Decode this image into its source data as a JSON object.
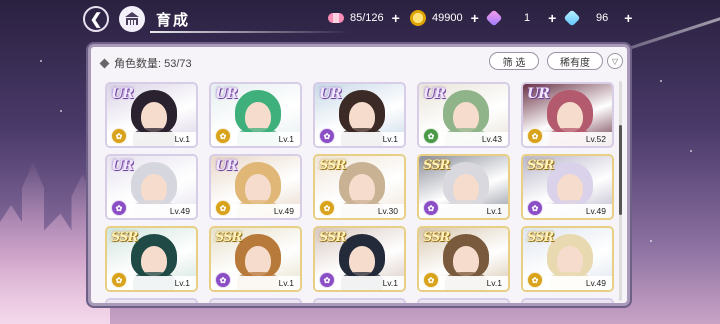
{
  "header": {
    "back_icon": "back-arrow-icon",
    "home_icon": "academy-icon",
    "title": "育成"
  },
  "resources": [
    {
      "icon": "candy-icon",
      "value": "85/126",
      "plus": "+"
    },
    {
      "icon": "coin-icon",
      "value": "49900",
      "plus": "+"
    },
    {
      "icon": "pink-gem-icon",
      "value": "1",
      "plus": "+"
    },
    {
      "icon": "blue-gem-icon",
      "value": "96",
      "plus": "+"
    }
  ],
  "panel": {
    "count_label": "角色数量: 53/73",
    "filter_label": "筛 选",
    "sort_label": "稀有度",
    "sort_toggle": "▽"
  },
  "colors": {
    "ur_accent": "#8b4fc5",
    "ssr_accent": "#d9a21b",
    "panel_bg": "#f6f4f8"
  },
  "cards": [
    {
      "rarity": "UR",
      "level": "Lv.1",
      "attr": "gold",
      "attr_icon": "feather-icon",
      "hair": "#2b2230",
      "bg": "#d9d2e6"
    },
    {
      "rarity": "UR",
      "level": "Lv.1",
      "attr": "gold",
      "attr_icon": "feather-icon",
      "hair": "#3fb07c",
      "bg": "#e6eef0"
    },
    {
      "rarity": "UR",
      "level": "Lv.1",
      "attr": "purple",
      "attr_icon": "leaf-icon",
      "hair": "#3b2a25",
      "bg": "#c8d9e8"
    },
    {
      "rarity": "UR",
      "level": "Lv.43",
      "attr": "green",
      "attr_icon": "leaf-icon",
      "hair": "#8fb48a",
      "bg": "#e8e4d8"
    },
    {
      "rarity": "UR",
      "level": "Lv.52",
      "attr": "gold",
      "attr_icon": "feather-icon",
      "hair": "#b45a6e",
      "bg": "#6a3144"
    },
    {
      "rarity": "UR",
      "level": "Lv.49",
      "attr": "purple",
      "attr_icon": "flower-icon",
      "hair": "#d6d6df",
      "bg": "#e6e2ee"
    },
    {
      "rarity": "UR",
      "level": "Lv.49",
      "attr": "gold",
      "attr_icon": "feather-icon",
      "hair": "#e0b777",
      "bg": "#e8d8c8"
    },
    {
      "rarity": "SSR",
      "level": "Lv.30",
      "attr": "gold",
      "attr_icon": "key-icon",
      "hair": "#c9b294",
      "bg": "#efe5d8"
    },
    {
      "rarity": "SSR",
      "level": "Lv.1",
      "attr": "purple",
      "attr_icon": "flower-icon",
      "hair": "#d8d8de",
      "bg": "#8c8f9c"
    },
    {
      "rarity": "SSR",
      "level": "Lv.49",
      "attr": "purple",
      "attr_icon": "leaf-icon",
      "hair": "#d9d2ea",
      "bg": "#b9b6c9"
    },
    {
      "rarity": "SSR",
      "level": "Lv.1",
      "attr": "gold",
      "attr_icon": "key-icon",
      "hair": "#1f4a46",
      "bg": "#cfe3dc"
    },
    {
      "rarity": "SSR",
      "level": "Lv.1",
      "attr": "purple",
      "attr_icon": "leaf-icon",
      "hair": "#b87a3a",
      "bg": "#e6e1c9"
    },
    {
      "rarity": "SSR",
      "level": "Lv.1",
      "attr": "purple",
      "attr_icon": "flower-icon",
      "hair": "#232a3a",
      "bg": "#d8c8c0"
    },
    {
      "rarity": "SSR",
      "level": "Lv.1",
      "attr": "gold",
      "attr_icon": "key-icon",
      "hair": "#7a5a3c",
      "bg": "#d8c8b0"
    },
    {
      "rarity": "SSR",
      "level": "Lv.49",
      "attr": "gold",
      "attr_icon": "key-icon",
      "hair": "#e8d9b0",
      "bg": "#dfe6ef"
    }
  ]
}
